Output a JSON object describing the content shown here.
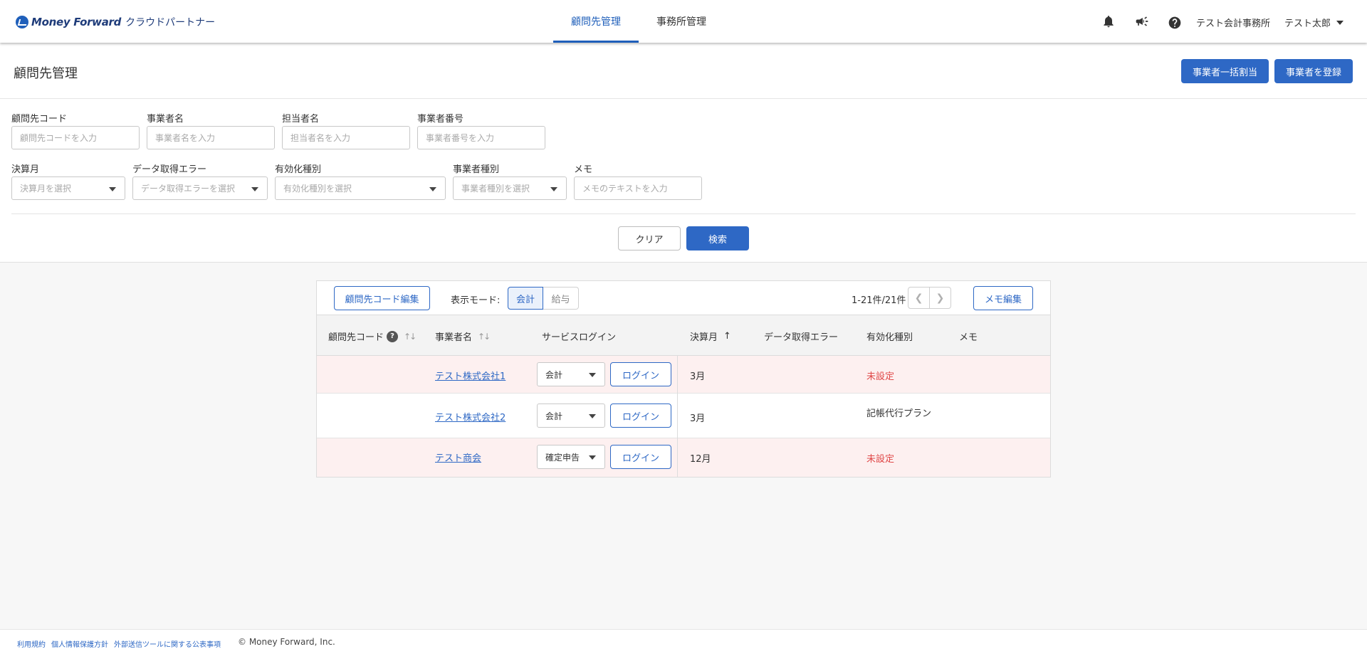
{
  "header": {
    "brand": "Money Forward",
    "product": "クラウドパートナー",
    "nav": [
      {
        "label": "顧問先管理",
        "active": true
      },
      {
        "label": "事務所管理",
        "active": false
      }
    ],
    "icons": [
      "bell-icon",
      "megaphone-icon",
      "help-icon"
    ],
    "office_name": "テスト会計事務所",
    "user_name": "テスト太郎"
  },
  "page": {
    "title": "顧問先管理",
    "bulk_assign_label": "事業者一括割当",
    "register_label": "事業者を登録"
  },
  "filters": {
    "client_code": {
      "label": "顧問先コード",
      "placeholder": "顧問先コードを入力"
    },
    "business_name": {
      "label": "事業者名",
      "placeholder": "事業者名を入力"
    },
    "staff_name": {
      "label": "担当者名",
      "placeholder": "担当者名を入力"
    },
    "business_number": {
      "label": "事業者番号",
      "placeholder": "事業者番号を入力"
    },
    "closing_month": {
      "label": "決算月",
      "placeholder": "決算月を選択"
    },
    "data_error": {
      "label": "データ取得エラー",
      "placeholder": "データ取得エラーを選択"
    },
    "activation_type": {
      "label": "有効化種別",
      "placeholder": "有効化種別を選択"
    },
    "business_type": {
      "label": "事業者種別",
      "placeholder": "事業者種別を選択"
    },
    "memo": {
      "label": "メモ",
      "placeholder": "メモのテキストを入力"
    },
    "clear_label": "クリア",
    "search_label": "検索"
  },
  "toolbar": {
    "edit_code_label": "顧問先コード編集",
    "mode_label": "表示モード:",
    "mode_options": [
      "会計",
      "給与"
    ],
    "mode_selected": "会計",
    "range_text": "1-21件/21件",
    "memo_edit_label": "メモ編集"
  },
  "table": {
    "columns": [
      "顧問先コード",
      "事業者名",
      "サービスログイン",
      "決算月",
      "データ取得エラー",
      "有効化種別",
      "メモ"
    ],
    "rows": [
      {
        "code": "",
        "name": "テスト株式会社1",
        "service": "会計",
        "login": "ログイン",
        "closing_month": "3月",
        "data_error": "",
        "activation": "未設定",
        "activation_alert": true,
        "memo": ""
      },
      {
        "code": "",
        "name": "テスト株式会社2",
        "service": "会計",
        "login": "ログイン",
        "closing_month": "3月",
        "data_error": "",
        "activation": "記帳代行プラン",
        "activation_alert": false,
        "memo": ""
      },
      {
        "code": "",
        "name": "テスト商会",
        "service": "確定申告",
        "login": "ログイン",
        "closing_month": "12月",
        "data_error": "",
        "activation": "未設定",
        "activation_alert": true,
        "memo": ""
      }
    ]
  },
  "footer": {
    "links": [
      "利用規約",
      "個人情報保護方針",
      "外部送信ツールに関する公表事項"
    ],
    "copyright": "© Money Forward, Inc."
  },
  "colors": {
    "primary": "#2e68c5",
    "alert_text": "#e04848",
    "alert_row": "#fdf0f0"
  }
}
